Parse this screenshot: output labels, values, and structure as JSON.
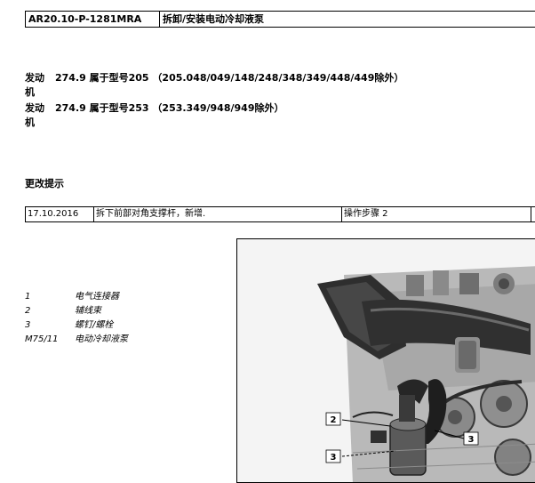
{
  "header": {
    "doc_number": "AR20.10-P-1281MRA",
    "title": "拆卸/安装电动冷却液泵"
  },
  "applicability": [
    {
      "label_line1": "发动",
      "label_line2": "机",
      "text": "274.9 属于型号205 （205.048/049/148/248/348/349/448/449除外）"
    },
    {
      "label_line1": "发动",
      "label_line2": "机",
      "text": "274.9 属于型号253 （253.349/948/949除外）"
    }
  ],
  "changes": {
    "heading": "更改提示",
    "rows": [
      {
        "date": "17.10.2016",
        "description": "拆下前部对角支撑杆，新增.",
        "step": "操作步骤 2"
      }
    ]
  },
  "legend": [
    {
      "num": "1",
      "text": "电气连接器"
    },
    {
      "num": "2",
      "text": "辅线束"
    },
    {
      "num": "3",
      "text": "螺钉/螺栓"
    },
    {
      "num": "M75/11",
      "text": "电动冷却液泵"
    }
  ],
  "figure": {
    "callouts": [
      "2",
      "3",
      "3"
    ]
  }
}
